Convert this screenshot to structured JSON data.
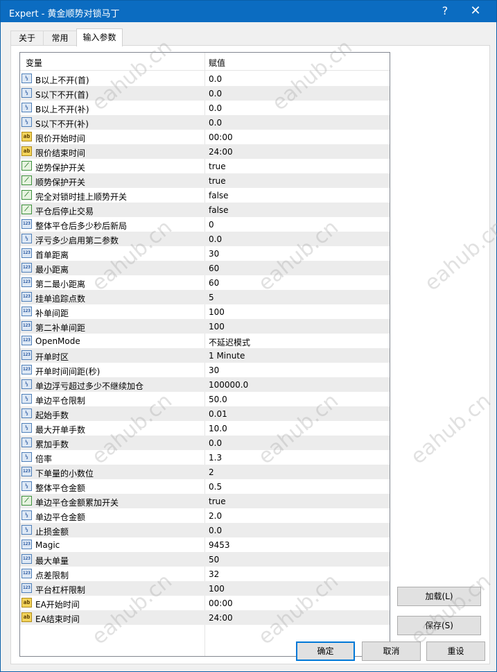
{
  "window": {
    "title": "Expert - 黄金顺势对锁马丁",
    "help": "?",
    "close": "✕"
  },
  "tabs": [
    "关于",
    "常用",
    "输入参数"
  ],
  "grid": {
    "col_variable": "变量",
    "col_value": "赋值",
    "rows": [
      {
        "type": "num",
        "name": "B以上不开(首)",
        "value": "0.0"
      },
      {
        "type": "num",
        "name": "S以下不开(首)",
        "value": "0.0"
      },
      {
        "type": "num",
        "name": "B以上不开(补)",
        "value": "0.0"
      },
      {
        "type": "num",
        "name": "S以下不开(补)",
        "value": "0.0"
      },
      {
        "type": "str",
        "name": "限价开始时间",
        "value": "00:00"
      },
      {
        "type": "str",
        "name": "限价结束时间",
        "value": "24:00"
      },
      {
        "type": "bool",
        "name": "逆势保护开关",
        "value": "true"
      },
      {
        "type": "bool",
        "name": "顺势保护开关",
        "value": "true"
      },
      {
        "type": "bool",
        "name": "完全对锁时挂上顺势开关",
        "value": "false"
      },
      {
        "type": "bool",
        "name": "平仓后停止交易",
        "value": "false"
      },
      {
        "type": "int",
        "name": "整体平仓后多少秒后新局",
        "value": "0"
      },
      {
        "type": "num",
        "name": "浮亏多少启用第二参数",
        "value": "0.0"
      },
      {
        "type": "int",
        "name": "首单距离",
        "value": "30"
      },
      {
        "type": "int",
        "name": "最小距离",
        "value": "60"
      },
      {
        "type": "int",
        "name": "第二最小距离",
        "value": "60"
      },
      {
        "type": "int",
        "name": "挂单追踪点数",
        "value": "5"
      },
      {
        "type": "int",
        "name": "补单间距",
        "value": "100"
      },
      {
        "type": "int",
        "name": "第二补单间距",
        "value": "100"
      },
      {
        "type": "int",
        "name": "OpenMode",
        "value": "不延迟模式"
      },
      {
        "type": "int",
        "name": "开单时区",
        "value": "1 Minute"
      },
      {
        "type": "int",
        "name": "开单时间间距(秒)",
        "value": "30"
      },
      {
        "type": "num",
        "name": "单边浮亏超过多少不继续加仓",
        "value": "100000.0"
      },
      {
        "type": "num",
        "name": "单边平仓限制",
        "value": "50.0"
      },
      {
        "type": "num",
        "name": "起始手数",
        "value": "0.01"
      },
      {
        "type": "num",
        "name": "最大开单手数",
        "value": "10.0"
      },
      {
        "type": "num",
        "name": "累加手数",
        "value": "0.0"
      },
      {
        "type": "num",
        "name": "倍率",
        "value": "1.3"
      },
      {
        "type": "int",
        "name": "下单量的小数位",
        "value": "2"
      },
      {
        "type": "num",
        "name": "整体平仓金额",
        "value": "0.5"
      },
      {
        "type": "bool",
        "name": "单边平仓金额累加开关",
        "value": "true"
      },
      {
        "type": "num",
        "name": "单边平仓金额",
        "value": "2.0"
      },
      {
        "type": "num",
        "name": "止损金额",
        "value": "0.0"
      },
      {
        "type": "int",
        "name": "Magic",
        "value": "9453"
      },
      {
        "type": "int",
        "name": "最大单量",
        "value": "50"
      },
      {
        "type": "int",
        "name": "点差限制",
        "value": "32"
      },
      {
        "type": "int",
        "name": "平台杠杆限制",
        "value": "100"
      },
      {
        "type": "str",
        "name": "EA开始时间",
        "value": "00:00"
      },
      {
        "type": "str",
        "name": "EA结束时间",
        "value": "24:00"
      }
    ]
  },
  "icon_glyphs": {
    "num": "½",
    "int": "123",
    "str": "ab",
    "bool": "⟋"
  },
  "buttons": {
    "load": "加载(L)",
    "save": "保存(S)",
    "ok": "确定",
    "cancel": "取消",
    "reset": "重设"
  },
  "watermark": "eahub.cn"
}
